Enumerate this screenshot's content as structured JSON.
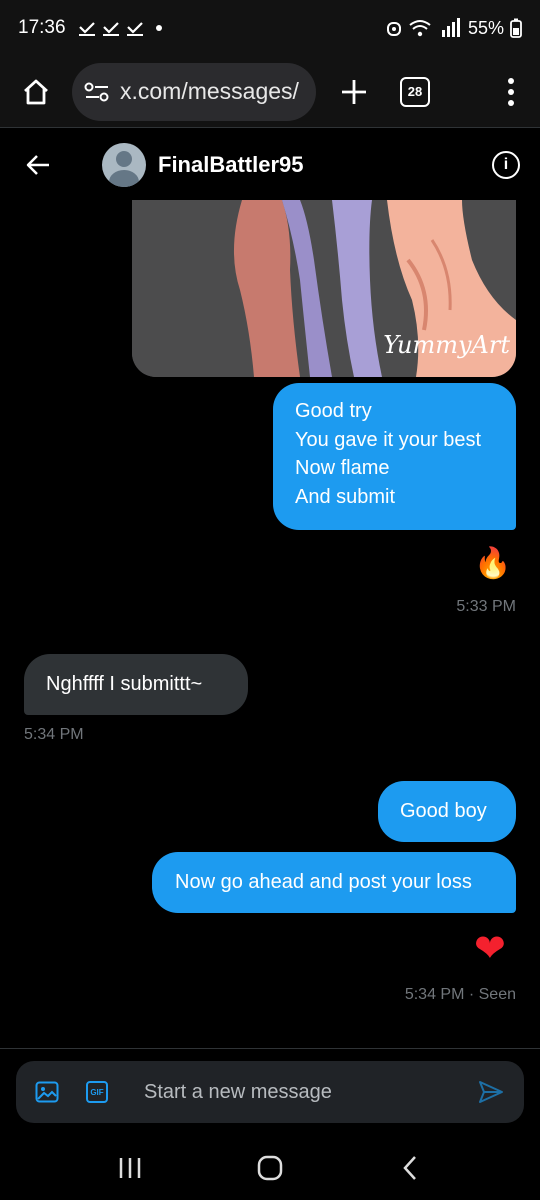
{
  "status_bar": {
    "time": "17:36",
    "battery": "55%"
  },
  "browser": {
    "url": "x.com/messages/",
    "tab_count": "28"
  },
  "chat": {
    "contact_name": "FinalBattler95"
  },
  "image_message": {
    "watermark": "YummyArt"
  },
  "messages": [
    {
      "direction": "out",
      "lines": [
        "Good try",
        "You gave it your best",
        "Now flame",
        "And submit"
      ]
    },
    {
      "direction": "in",
      "text": "Nghffff I submittt~"
    },
    {
      "direction": "out",
      "text": "Good boy"
    },
    {
      "direction": "out",
      "text": "Now go ahead and post your loss"
    }
  ],
  "reactions": {
    "fire": "🔥",
    "heart": "❤"
  },
  "timestamps": {
    "t1": "5:33 PM",
    "t2": "5:34 PM",
    "t3": "5:34 PM · Seen"
  },
  "composer": {
    "placeholder": "Start a new message",
    "gif_label": "GIF"
  },
  "colors": {
    "accent": "#1d9bf0",
    "incoming_bubble": "#2f3336",
    "heart": "#f4212e"
  }
}
